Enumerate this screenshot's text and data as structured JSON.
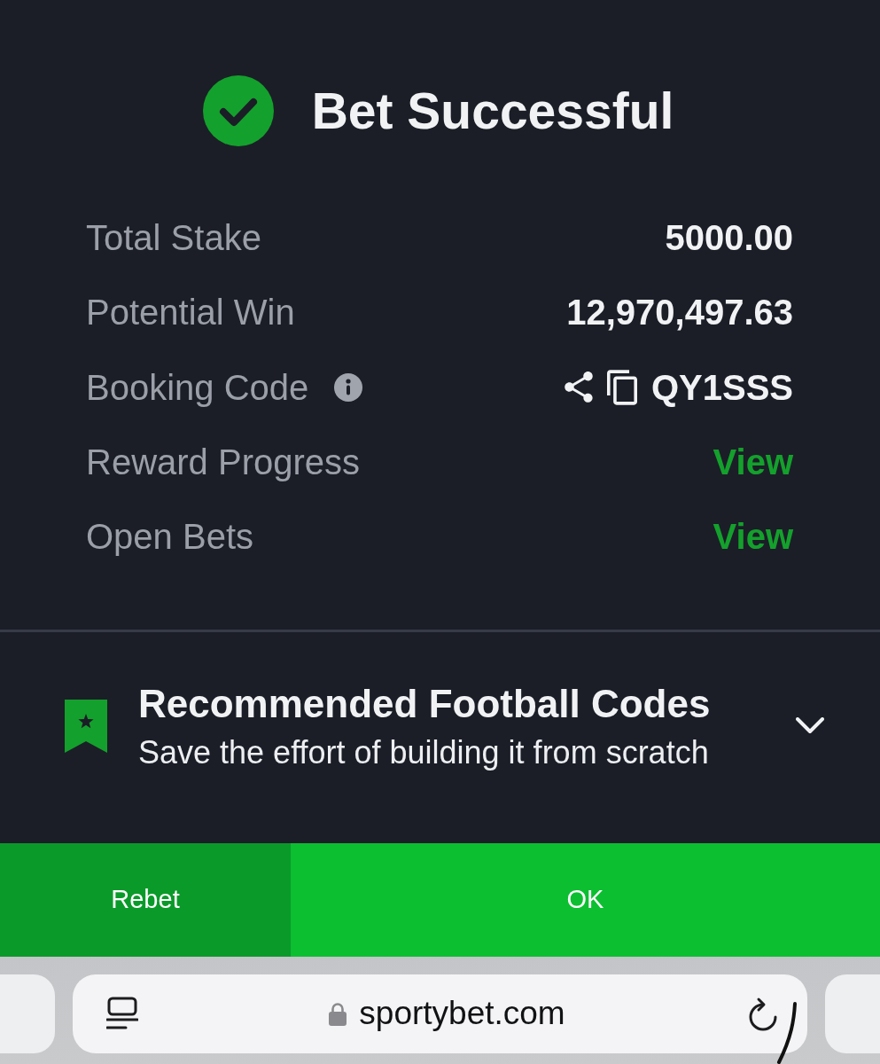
{
  "header": {
    "title": "Bet Successful"
  },
  "summary": [
    {
      "label": "Total Stake",
      "value": "5000.00",
      "kind": "amount"
    },
    {
      "label": "Potential Win",
      "value": "12,970,497.63",
      "kind": "amount"
    },
    {
      "label": "Booking Code",
      "value": "QY1SSS",
      "kind": "code"
    },
    {
      "label": "Reward Progress",
      "value": "View",
      "kind": "link"
    },
    {
      "label": "Open Bets",
      "value": "View",
      "kind": "link"
    }
  ],
  "recommended": {
    "title": "Recommended Football Codes",
    "subtitle": "Save the effort of building it from scratch",
    "expanded": false
  },
  "buttons": [
    {
      "label": "Rebet",
      "kind": "secondary"
    },
    {
      "label": "OK",
      "kind": "primary"
    }
  ],
  "browser": {
    "url": "sportybet.com",
    "secure": true
  }
}
